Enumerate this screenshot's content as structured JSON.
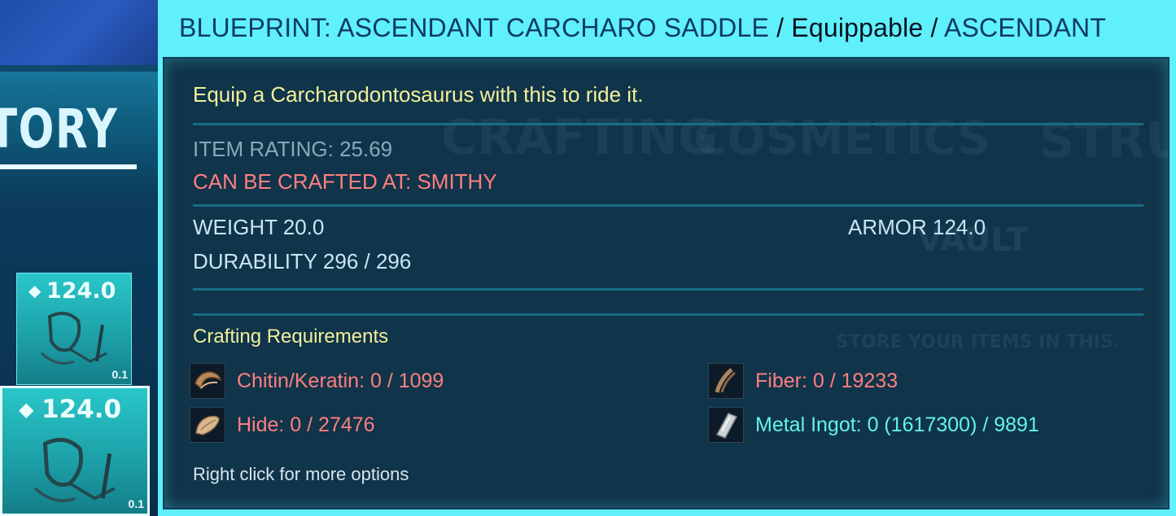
{
  "background": {
    "inventory_title": "TORY",
    "slots": [
      {
        "armor": "124.0",
        "quality": "0.1"
      },
      {
        "armor": "124.0",
        "quality": "0.1"
      }
    ],
    "ghost_labels": {
      "crafting": "CRAFTING",
      "cosmetics": "COSMETICS",
      "structures": "STRUCT",
      "vault": "VAULT",
      "vault_desc": "STORE YOUR ITEMS IN THIS."
    }
  },
  "tooltip": {
    "header": {
      "name": "BLUEPRINT: ASCENDANT CARCHARO SADDLE",
      "sep1": "/",
      "type": "Equippable",
      "sep2": "/",
      "quality": "ASCENDANT"
    },
    "description": "Equip a Carcharodontosaurus with this to ride it.",
    "item_rating": "ITEM RATING: 25.69",
    "crafted_at": "CAN BE CRAFTED AT: SMITHY",
    "weight": "WEIGHT 20.0",
    "armor": "ARMOR 124.0",
    "durability": "DURABILITY 296 / 296",
    "requirements_title": "Crafting Requirements",
    "requirements": [
      {
        "label": "Chitin/Keratin: 0 / 1099",
        "icon": "chitin-icon",
        "status": "insufficient"
      },
      {
        "label": "Hide: 0 / 27476",
        "icon": "hide-icon",
        "status": "insufficient"
      },
      {
        "label": "Fiber: 0 / 19233",
        "icon": "fiber-icon",
        "status": "insufficient"
      },
      {
        "label": "Metal Ingot: 0 (1617300) / 9891",
        "icon": "metal-ingot-icon",
        "status": "available"
      }
    ],
    "hint": "Right click for more options"
  },
  "colors": {
    "header_bg": "#5ff0fb",
    "header_name": "#0f3a66",
    "description": "#f3ef9a",
    "insufficient": "#ff7f7f",
    "available": "#63f3e8",
    "stat": "#c9e6f3"
  }
}
